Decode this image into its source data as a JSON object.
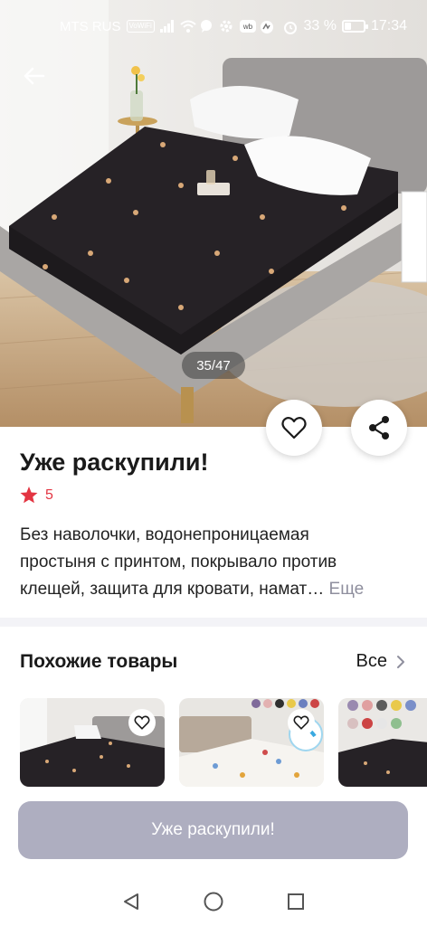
{
  "status_bar": {
    "carrier": "MTS RUS",
    "wifi_badge": "VoWiFi",
    "battery_percent": "33 %",
    "battery_level": 0.33,
    "time": "17:34",
    "icons": [
      "signal-icon",
      "wifi-icon",
      "chat-icon",
      "gear-icon",
      "wb-icon",
      "app-icon",
      "alarm-icon"
    ]
  },
  "gallery": {
    "counter": "35/47"
  },
  "product": {
    "title": "Уже раскупили!",
    "rating": "5",
    "description_lines": [
      "Без наволочки, водонепроницаемая",
      "простыня с принтом, покрывало против",
      "клещей, защита для кровати, намат…"
    ],
    "more_label": "Еще"
  },
  "similar": {
    "title": "Похожие товары",
    "all_label": "Все"
  },
  "action": {
    "sold_out_label": "Уже раскупили!"
  },
  "colors": {
    "accent_red": "#e33542",
    "button_disabled": "#aeaec0",
    "muted_text": "#8f8f9e"
  }
}
